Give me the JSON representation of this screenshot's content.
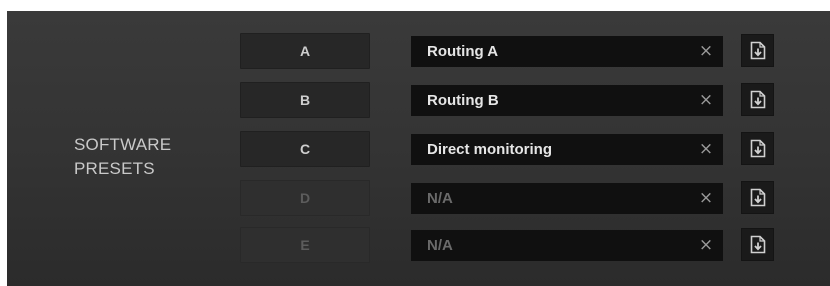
{
  "section": {
    "label_line1": "SOFTWARE",
    "label_line2": "PRESETS"
  },
  "presets": [
    {
      "slot": "A",
      "name": "Routing A",
      "active": true,
      "clear_symbol": "×",
      "load_icon": "file-import-icon"
    },
    {
      "slot": "B",
      "name": "Routing B",
      "active": true,
      "clear_symbol": "×",
      "load_icon": "file-import-icon"
    },
    {
      "slot": "C",
      "name": "Direct monitoring",
      "active": true,
      "clear_symbol": "×",
      "load_icon": "file-import-icon"
    },
    {
      "slot": "D",
      "name": "N/A",
      "active": false,
      "clear_symbol": "×",
      "load_icon": "file-import-icon"
    },
    {
      "slot": "E",
      "name": "N/A",
      "active": false,
      "clear_symbol": "×",
      "load_icon": "file-import-icon"
    }
  ],
  "colors": {
    "panel_bg": "#363636",
    "button_bg": "#272727",
    "field_bg": "#101010",
    "text_active": "#e6e6e6",
    "text_inactive": "#6a6a6a",
    "icon_color": "#d0d0d0"
  }
}
